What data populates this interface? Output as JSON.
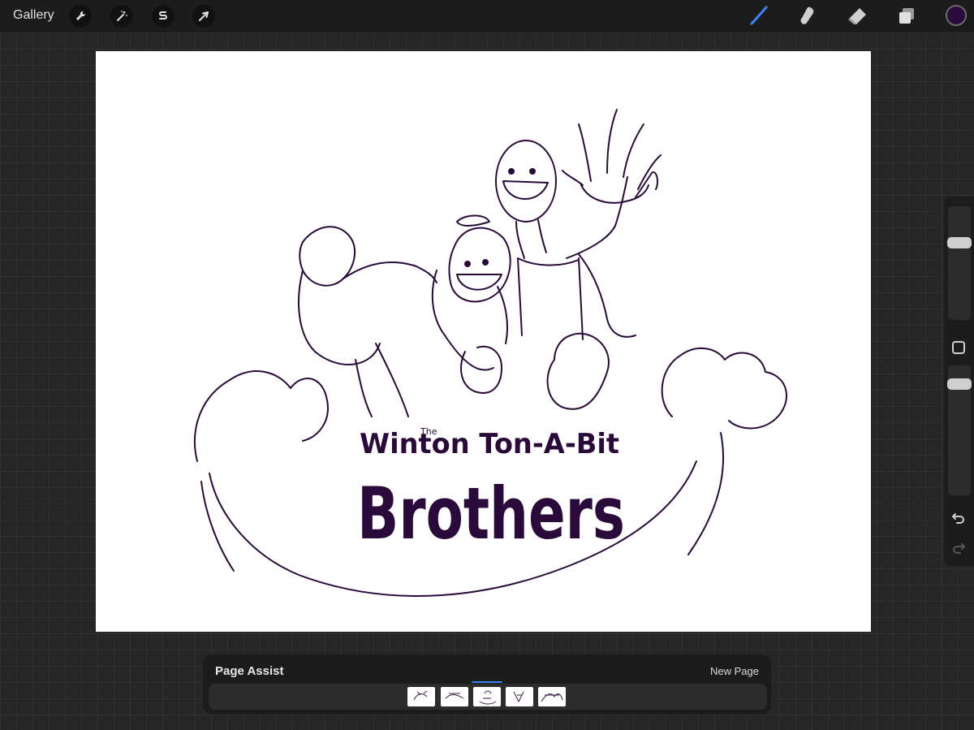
{
  "toolbar": {
    "gallery_label": "Gallery",
    "left_tools": [
      {
        "icon": "wrench-icon",
        "name": "actions-button"
      },
      {
        "icon": "magic-wand-icon",
        "name": "adjustments-button"
      },
      {
        "icon": "selection-s-icon",
        "name": "selection-button"
      },
      {
        "icon": "arrow-cursor-icon",
        "name": "transform-button"
      }
    ],
    "right_tools": [
      {
        "icon": "brush-icon",
        "name": "brush-tool",
        "active": true
      },
      {
        "icon": "smudge-icon",
        "name": "smudge-tool",
        "active": false
      },
      {
        "icon": "eraser-icon",
        "name": "eraser-tool",
        "active": false
      },
      {
        "icon": "layers-icon",
        "name": "layers-button",
        "active": false
      }
    ],
    "active_color": "#2a0a3a",
    "accent": "#3b82f6"
  },
  "canvas": {
    "title_small": "The",
    "title_line1": "Winton Ton-A-Bit",
    "title_line2": "Brothers",
    "ink_color": "#2a0a3a"
  },
  "sidebar": {
    "brush_size_level": 0.13,
    "opacity_level": 0.1,
    "undo_icon": "undo-icon",
    "redo_icon": "redo-icon"
  },
  "page_assist": {
    "title": "Page Assist",
    "new_page_label": "New Page",
    "pages": [
      {
        "label": "page-1"
      },
      {
        "label": "page-2"
      },
      {
        "label": "page-3",
        "active": true
      },
      {
        "label": "page-4"
      },
      {
        "label": "page-5"
      }
    ]
  }
}
